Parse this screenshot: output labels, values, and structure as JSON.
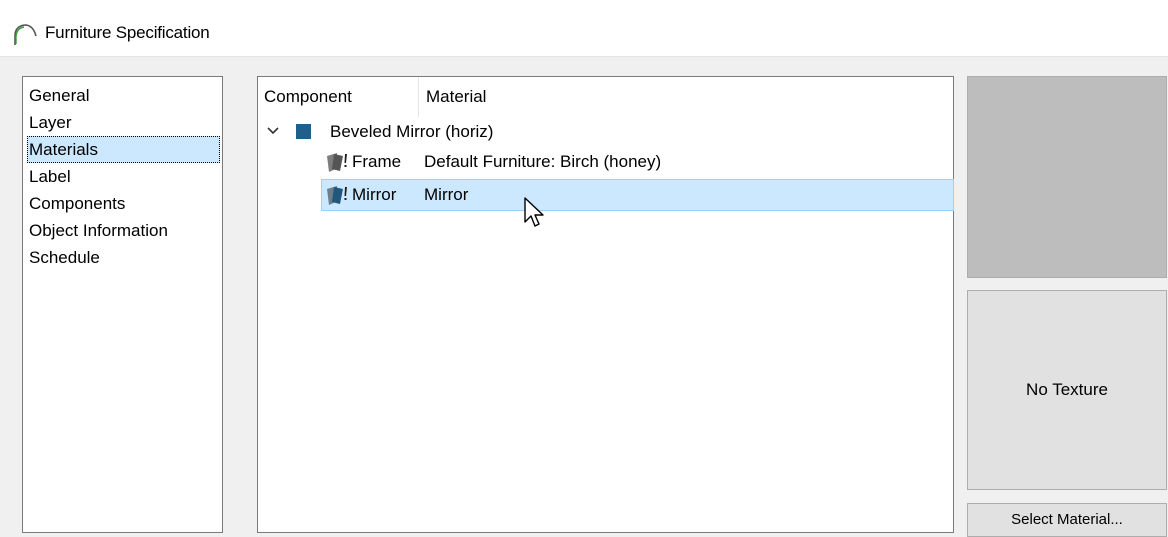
{
  "window": {
    "title": "Furniture Specification"
  },
  "nav": {
    "items": [
      {
        "label": "General"
      },
      {
        "label": "Layer"
      },
      {
        "label": "Materials",
        "selected": true
      },
      {
        "label": "Label"
      },
      {
        "label": "Components"
      },
      {
        "label": "Object Information"
      },
      {
        "label": "Schedule"
      }
    ]
  },
  "tree": {
    "columns": [
      "Component",
      "Material"
    ],
    "parent": {
      "label": "Beveled Mirror (horiz)",
      "expanded": true,
      "swatch_color": "#1f5f8b"
    },
    "rows": [
      {
        "component": "Frame",
        "material": "Default Furniture: Birch (honey)",
        "selected": false
      },
      {
        "component": "Mirror",
        "material": "Mirror",
        "selected": true
      }
    ]
  },
  "preview": {
    "no_texture_label": "No Texture"
  },
  "buttons": {
    "select_material": "Select Material..."
  },
  "colors": {
    "selection": "#cce8ff",
    "selection_border": "#99d1ff",
    "swatch": "#1f5f8b",
    "preview_top": "#bdbdbd",
    "preview_bottom": "#e1e1e1"
  }
}
